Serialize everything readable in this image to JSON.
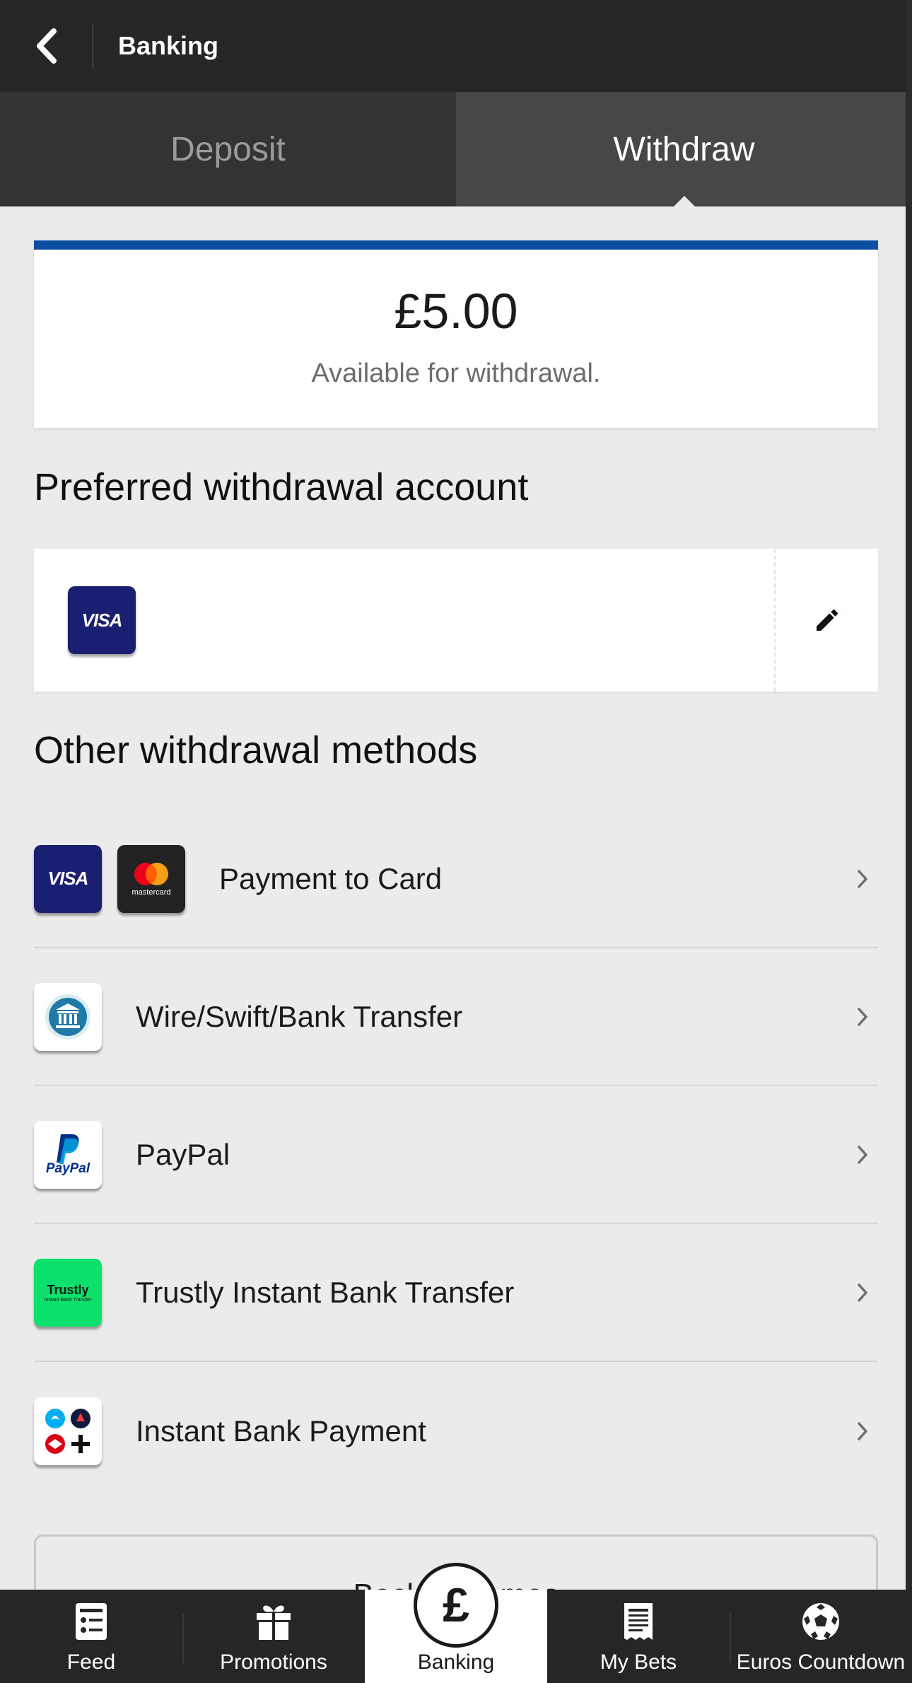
{
  "header": {
    "title": "Banking"
  },
  "tabs": [
    {
      "label": "Deposit",
      "active": false
    },
    {
      "label": "Withdraw",
      "active": true
    }
  ],
  "balance": {
    "amount": "£5.00",
    "label": "Available for withdrawal."
  },
  "preferred": {
    "heading": "Preferred withdrawal account",
    "card_logo": "VISA"
  },
  "other": {
    "heading": "Other withdrawal methods",
    "methods": [
      {
        "label": "Payment to Card",
        "icons": [
          "visa-logo",
          "mastercard-logo"
        ]
      },
      {
        "label": "Wire/Swift/Bank Transfer",
        "icons": [
          "bank-icon"
        ]
      },
      {
        "label": "PayPal",
        "icons": [
          "paypal-logo"
        ]
      },
      {
        "label": "Trustly Instant Bank Transfer",
        "icons": [
          "trustly-logo"
        ]
      },
      {
        "label": "Instant Bank Payment",
        "icons": [
          "bank-logos-icon"
        ]
      }
    ]
  },
  "logos": {
    "visa": "VISA",
    "mastercard": "mastercard",
    "paypal": "PayPal",
    "trustly": "Trustly",
    "trustly_sub": "Instant Bank Transfer"
  },
  "back_button": {
    "label": "Back to games"
  },
  "nav": [
    {
      "label": "Feed",
      "icon": "feed-icon"
    },
    {
      "label": "Promotions",
      "icon": "gift-icon"
    },
    {
      "label": "Banking",
      "icon": "pound-icon",
      "active": true
    },
    {
      "label": "My Bets",
      "icon": "betslip-icon"
    },
    {
      "label": "Euros Countdown",
      "icon": "football-icon"
    }
  ],
  "colors": {
    "header_bg": "#262626",
    "accent_blue": "#0b4ea2",
    "visa_blue": "#1a1f71",
    "trustly_green": "#0ee06e"
  }
}
